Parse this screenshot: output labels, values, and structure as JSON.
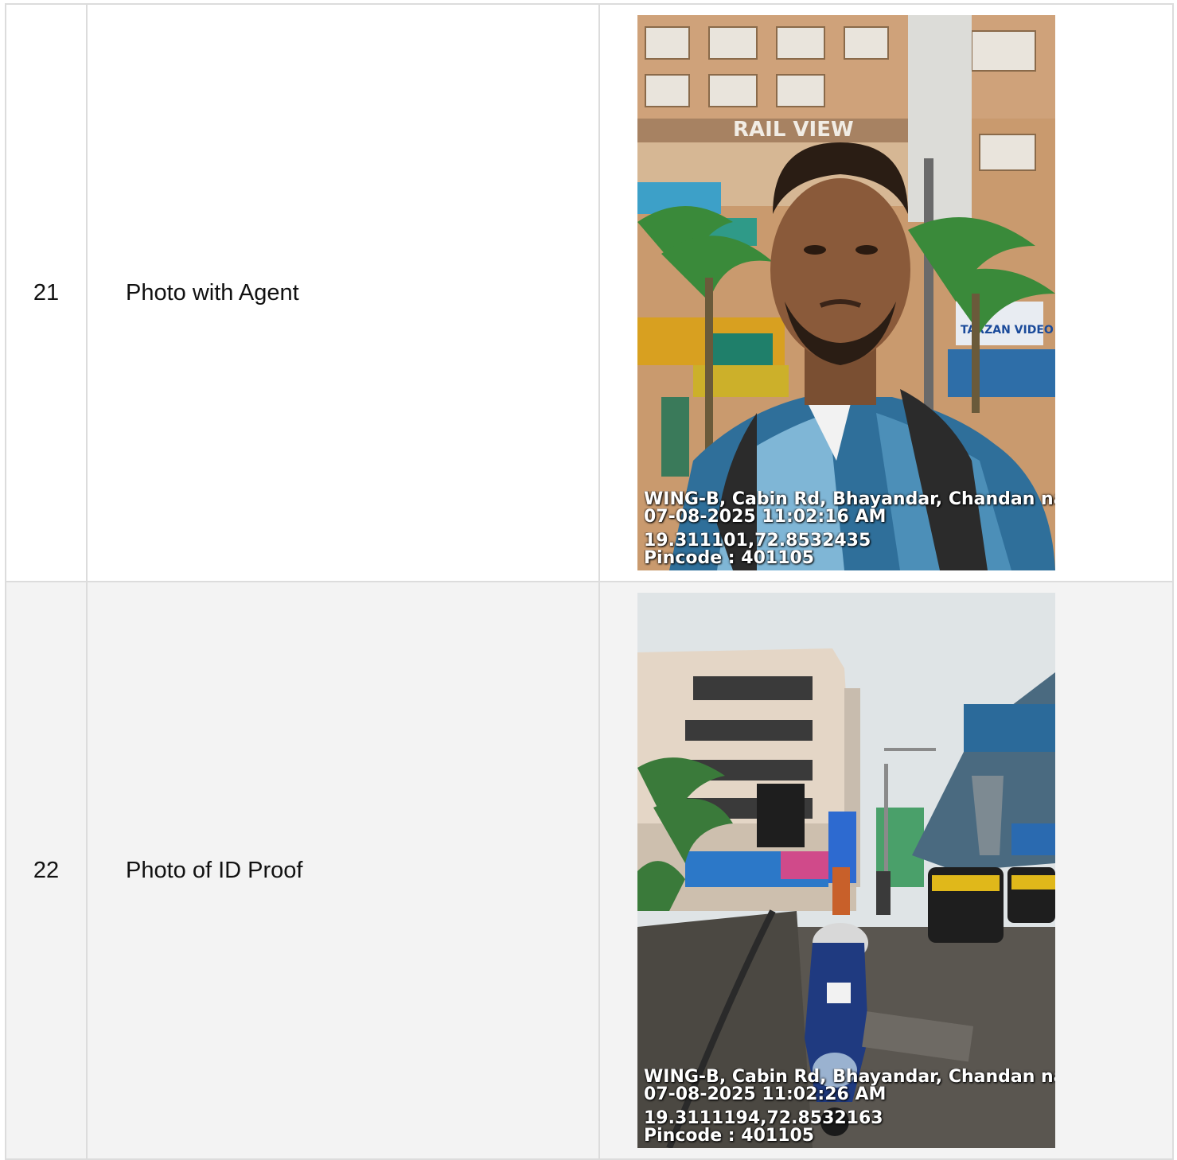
{
  "rows": [
    {
      "number": "21",
      "label": "Photo with Agent",
      "stamp": {
        "address": "WING-B, Cabin Rd, Bhayandar, Chandan naga",
        "datetime": "07-08-2025 11:02:16 AM",
        "coords": "19.311101,72.8532435",
        "pincode": "Pincode : 401105"
      },
      "signs": {
        "building": "RAIL VIEW",
        "shop": "TARZAN VIDEO"
      }
    },
    {
      "number": "22",
      "label": "Photo of ID Proof",
      "stamp": {
        "address": "WING-B, Cabin Rd, Bhayandar, Chandan naga",
        "datetime": "07-08-2025 11:02:26 AM",
        "coords": "19.3111194,72.8532163",
        "pincode": "Pincode : 401105"
      }
    }
  ]
}
